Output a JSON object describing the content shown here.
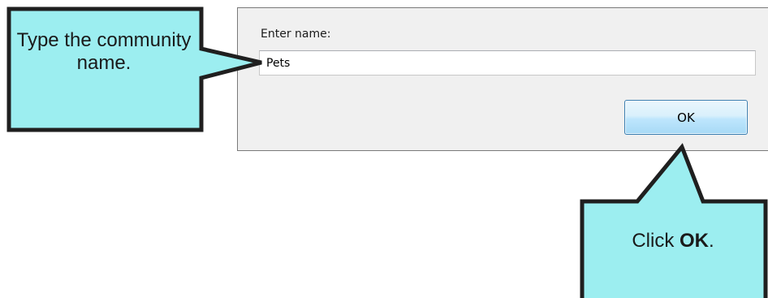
{
  "dialog": {
    "prompt_label": "Enter name:",
    "name_value": "Pets",
    "ok_label": "OK"
  },
  "callouts": {
    "left": {
      "text": "Type the community name."
    },
    "right": {
      "prefix": "Click ",
      "emphasis": "OK",
      "suffix": "."
    }
  },
  "colors": {
    "callout_fill": "#9ceef0",
    "callout_stroke": "#1f1f1f",
    "button_border": "#3c7fb1",
    "dialog_background": "#f0f0f0"
  }
}
